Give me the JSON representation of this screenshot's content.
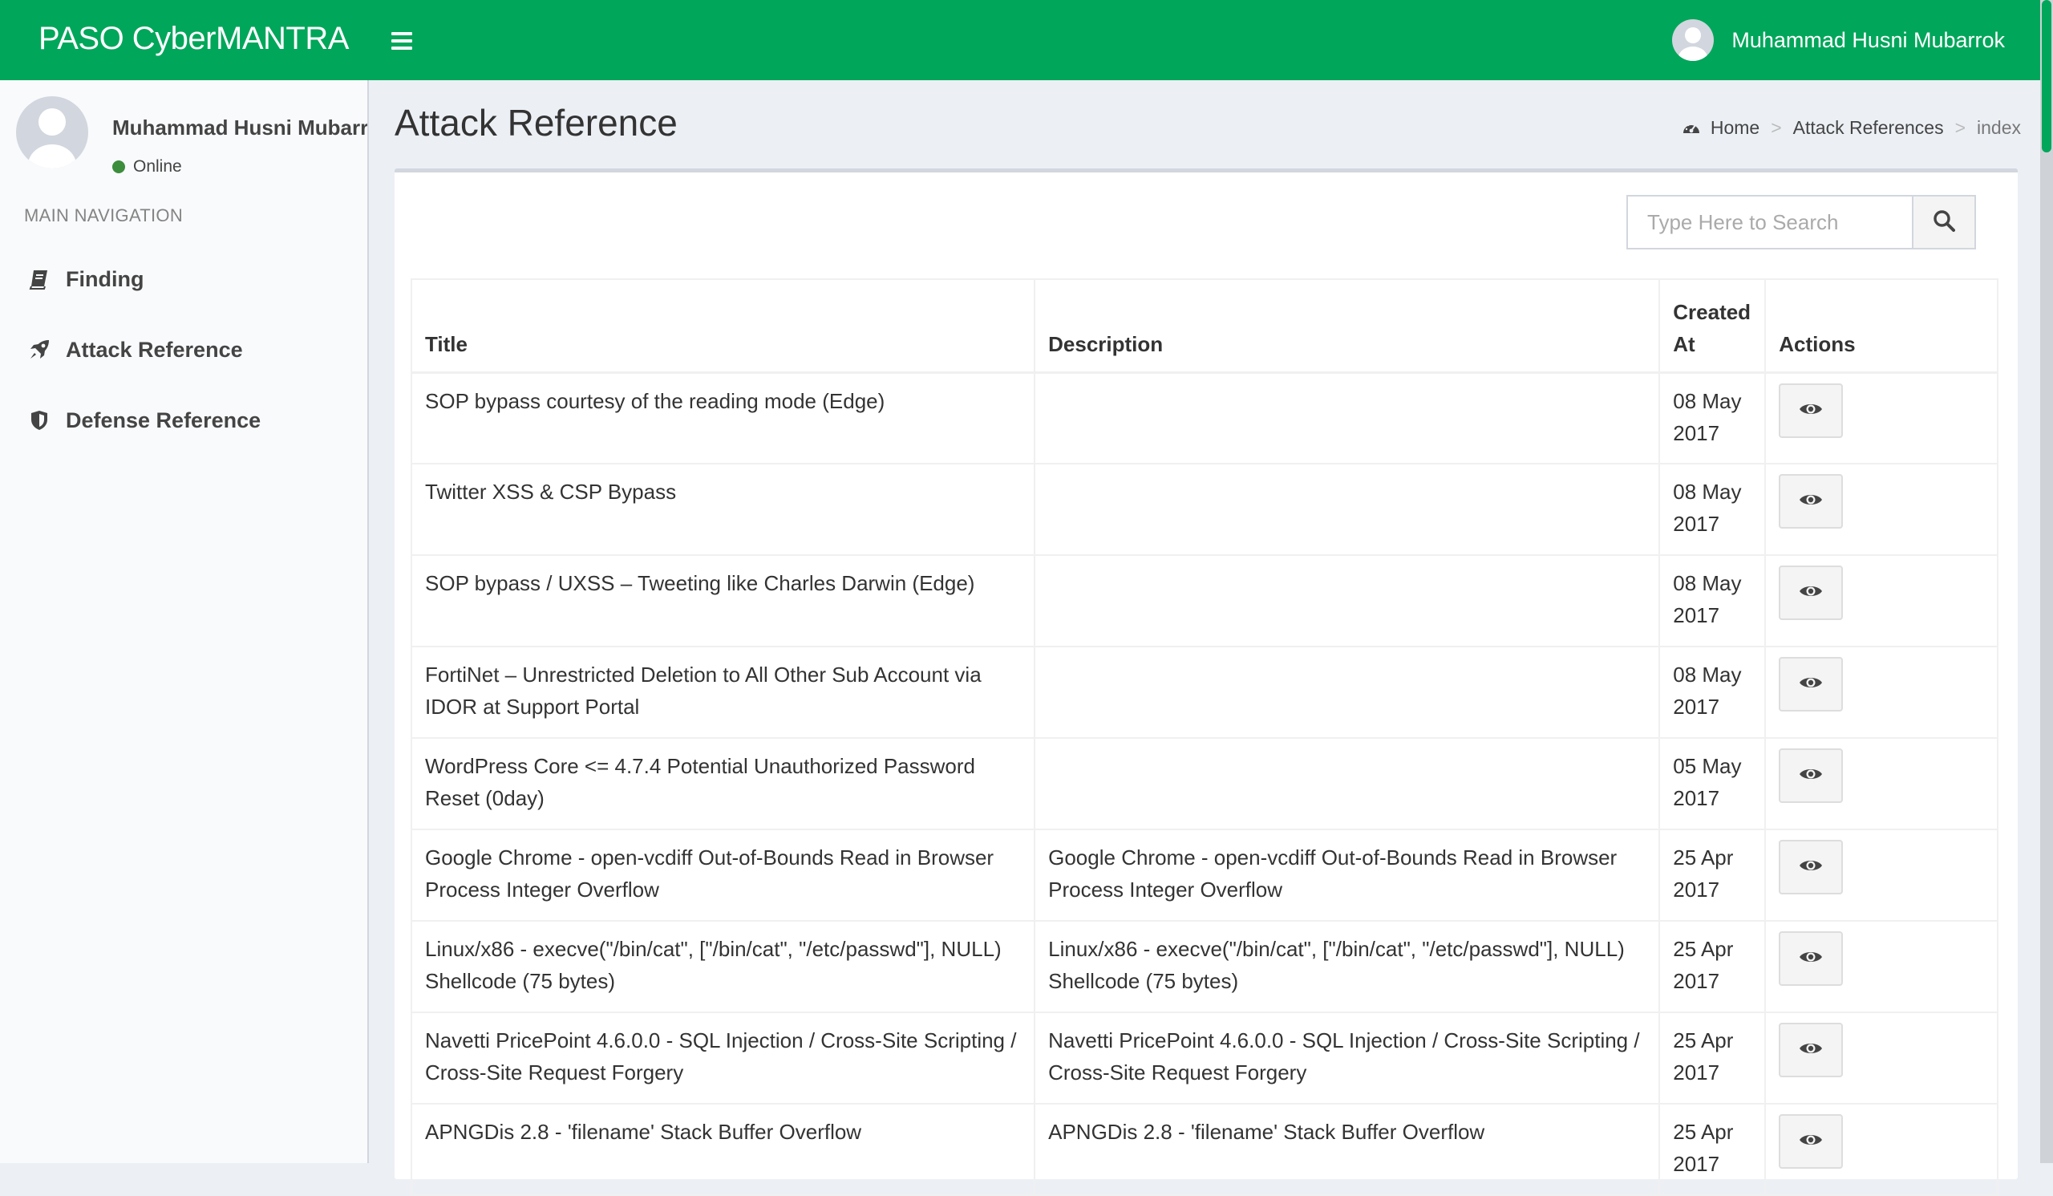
{
  "app": {
    "brand": "PASO CyberMANTRA",
    "user_name": "Muhammad Husni Mubarrok"
  },
  "sidebar": {
    "user_name": "Muhammad Husni Mubarrok",
    "status": "Online",
    "nav_header": "MAIN NAVIGATION",
    "items": [
      {
        "label": "Finding",
        "icon": "book-icon"
      },
      {
        "label": "Attack Reference",
        "icon": "rocket-icon"
      },
      {
        "label": "Defense Reference",
        "icon": "shield-icon"
      }
    ]
  },
  "page": {
    "title": "Attack Reference",
    "breadcrumb": [
      "Home",
      "Attack References",
      "index"
    ]
  },
  "search": {
    "placeholder": "Type Here to Search"
  },
  "table": {
    "columns": [
      "Title",
      "Description",
      "Created At",
      "Actions"
    ],
    "rows": [
      {
        "title": "SOP bypass courtesy of the reading mode (Edge)",
        "description": "",
        "created_at": "08 May 2017"
      },
      {
        "title": "Twitter XSS & CSP Bypass",
        "description": "",
        "created_at": "08 May 2017"
      },
      {
        "title": "SOP bypass / UXSS – Tweeting like Charles Darwin (Edge)",
        "description": "",
        "created_at": "08 May 2017"
      },
      {
        "title": "FortiNet – Unrestricted Deletion to All Other Sub Account via IDOR at Support Portal",
        "description": "",
        "created_at": "08 May 2017"
      },
      {
        "title": "WordPress Core <= 4.7.4 Potential Unauthorized Password Reset (0day)",
        "description": "",
        "created_at": "05 May 2017"
      },
      {
        "title": "Google Chrome - open-vcdiff Out-of-Bounds Read in Browser Process Integer Overflow",
        "description": "Google Chrome - open-vcdiff Out-of-Bounds Read in Browser Process Integer Overflow",
        "created_at": "25 Apr 2017"
      },
      {
        "title": "Linux/x86 - execve(\"/bin/cat\", [\"/bin/cat\", \"/etc/passwd\"], NULL) Shellcode (75 bytes)",
        "description": "Linux/x86 - execve(\"/bin/cat\", [\"/bin/cat\", \"/etc/passwd\"], NULL) Shellcode (75 bytes)",
        "created_at": "25 Apr 2017"
      },
      {
        "title": "Navetti PricePoint 4.6.0.0 - SQL Injection / Cross-Site Scripting / Cross-Site Request Forgery",
        "description": "Navetti PricePoint 4.6.0.0 - SQL Injection / Cross-Site Scripting / Cross-Site Request Forgery",
        "created_at": "25 Apr 2017"
      },
      {
        "title": "APNGDis 2.8 - 'filename' Stack Buffer Overflow",
        "description": "APNGDis 2.8 - 'filename' Stack Buffer Overflow",
        "created_at": "25 Apr 2017"
      }
    ]
  },
  "colors": {
    "header": "#00a65a",
    "body_bg": "#ecf0f5",
    "sidebar_bg": "#f9fafc",
    "status_online": "#3c8d3c"
  }
}
